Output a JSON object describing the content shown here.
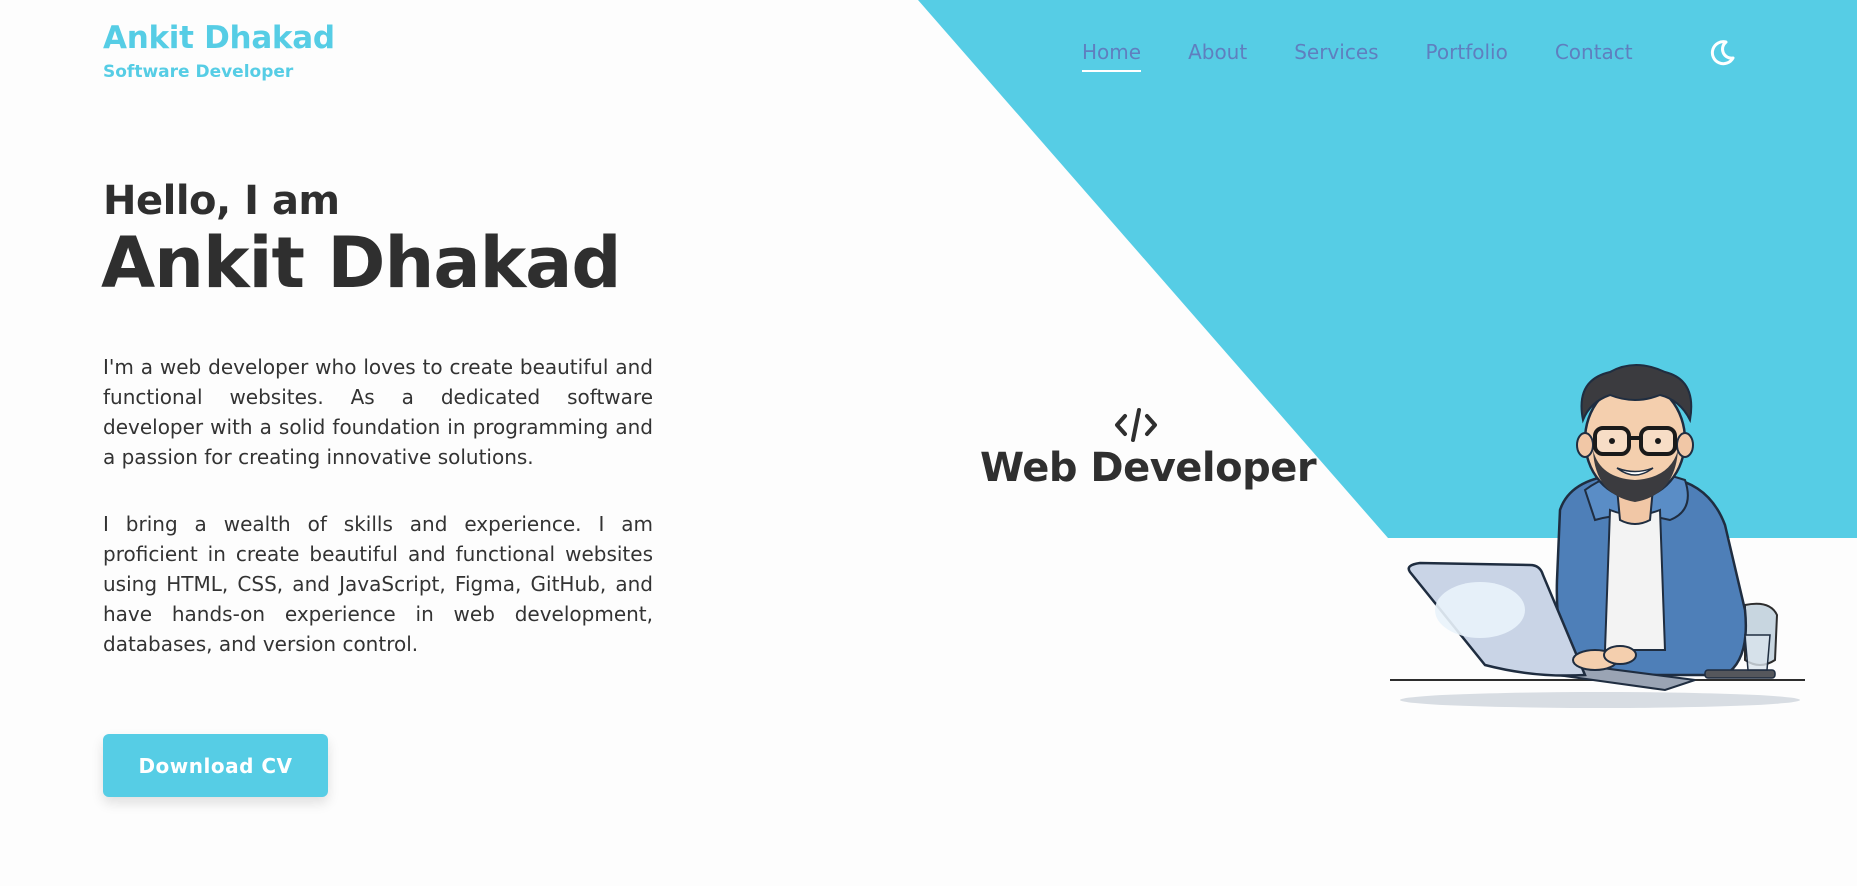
{
  "brand": {
    "name": "Ankit Dhakad",
    "tagline": "Software Developer",
    "accent_color": "#56cde5"
  },
  "nav": {
    "items": [
      {
        "label": "Home",
        "active": true
      },
      {
        "label": "About",
        "active": false
      },
      {
        "label": "Services",
        "active": false
      },
      {
        "label": "Portfolio",
        "active": false
      },
      {
        "label": "Contact",
        "active": false
      }
    ],
    "theme_toggle_icon": "moon-icon"
  },
  "hero": {
    "greeting": "Hello, I am",
    "name": "Ankit Dhakad",
    "paragraphs": [
      "I'm a web developer who loves to create beautiful and functional websites. As a dedicated software developer with a solid foundation in programming and a passion for creating innovative solutions.",
      "I bring a wealth of skills and experience. I am proficient in create beautiful and functional websites using HTML, CSS, and JavaScript, Figma, GitHub, and have hands-on experience in web development, databases, and version control."
    ],
    "cta_label": "Download CV"
  },
  "role": {
    "icon": "code-icon",
    "title": "Web Developer"
  },
  "illustration": {
    "icon": "developer-with-laptop-illustration"
  }
}
